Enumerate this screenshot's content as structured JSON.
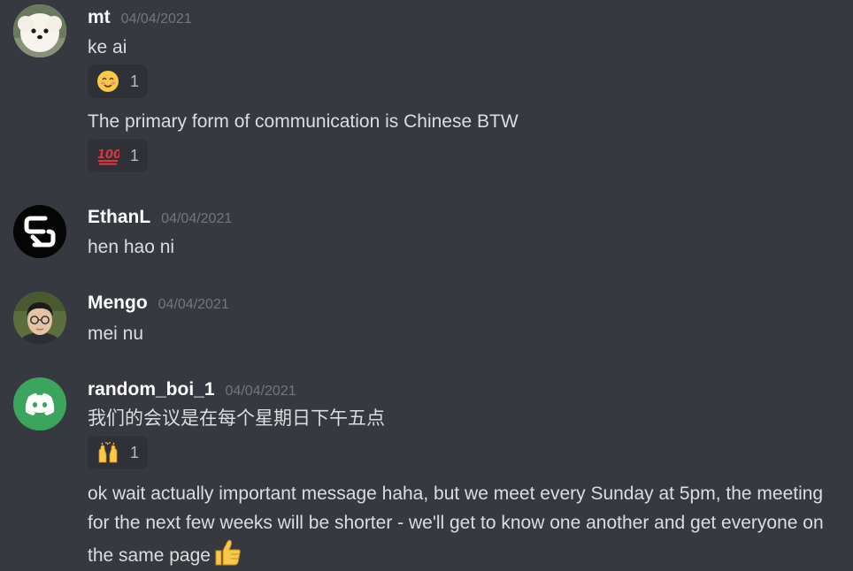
{
  "messages": [
    {
      "username": "mt",
      "timestamp": "04/04/2021",
      "avatar": "white-fluffy-dog-avatar",
      "lines": [
        {
          "text": "ke ai",
          "reaction": {
            "emoji": "smiling-face-icon",
            "count": "1"
          }
        },
        {
          "text": "The primary form of communication is Chinese BTW",
          "reaction": {
            "emoji": "hundred-points-icon",
            "count": "1"
          }
        }
      ]
    },
    {
      "username": "EthanL",
      "timestamp": "04/04/2021",
      "avatar": "sk-logo-avatar",
      "lines": [
        {
          "text": "hen hao ni"
        }
      ]
    },
    {
      "username": "Mengo",
      "timestamp": "04/04/2021",
      "avatar": "person-glasses-avatar",
      "lines": [
        {
          "text": "mei nu"
        }
      ]
    },
    {
      "username": "random_boi_1",
      "timestamp": "04/04/2021",
      "avatar": "discord-logo-avatar",
      "lines": [
        {
          "text": "我们的会议是在每个星期日下午五点",
          "reaction": {
            "emoji": "raising-hands-icon",
            "count": "1"
          }
        },
        {
          "text": "ok wait actually important message haha, but we meet every Sunday at 5pm, the meeting for the next few weeks will be shorter - we'll get to know one another and get everyone on the same page",
          "trailing_emoji": "thumbs-up-icon"
        }
      ]
    }
  ],
  "colors": {
    "background": "#36393f",
    "reaction_bg": "#2f3136",
    "username": "#ffffff",
    "timestamp": "#72767d",
    "text": "#dcddde",
    "discord_green": "#3ba55d"
  }
}
